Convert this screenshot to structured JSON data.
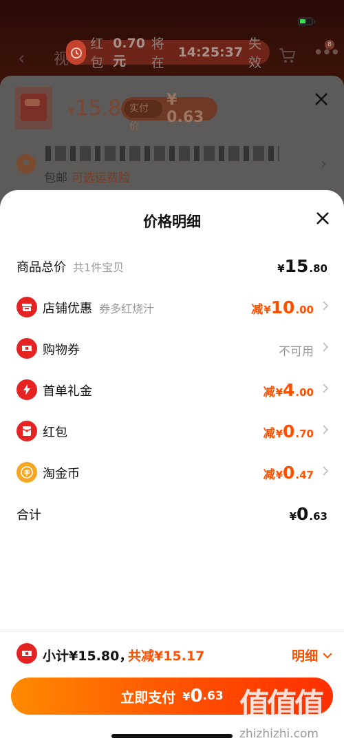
{
  "status_bar": {
    "battery_color": "#3ddc52"
  },
  "background_page": {
    "nav_back_glyph": "‹",
    "nav_title_partial": "视",
    "countdown": {
      "label": "红包",
      "amount": "0.70元",
      "mid": "将在",
      "time": "14:25:37",
      "suffix": "失效"
    },
    "cart_badge": "8",
    "product": {
      "yen": "¥",
      "price": "15.8",
      "pay_label": "实付价",
      "pay_value": "¥ 0.63"
    },
    "shipping": {
      "free": "包邮",
      "insurance": "可选运费险"
    }
  },
  "price_sheet": {
    "title": "价格明细",
    "rows": [
      {
        "label": "商品总价",
        "sub": "共1件宝贝",
        "yen": "¥",
        "int": "15",
        "dec": ".80"
      },
      {
        "label": "店铺优惠",
        "sub": "券多红烧汁",
        "minus": "减",
        "yen": "¥",
        "int": "10",
        "dec": ".00"
      },
      {
        "label": "购物券",
        "status": "不可用"
      },
      {
        "label": "首单礼金",
        "minus": "减",
        "yen": "¥",
        "int": "4",
        "dec": ".00"
      },
      {
        "label": "红包",
        "minus": "减",
        "yen": "¥",
        "int": "0",
        "dec": ".70"
      },
      {
        "label": "淘金币",
        "minus": "减",
        "yen": "¥",
        "int": "0",
        "dec": ".47"
      },
      {
        "label": "合计",
        "yen": "¥",
        "int": "0",
        "dec": ".63"
      }
    ],
    "icons": [
      "store-icon",
      "coupon-icon",
      "lightning-icon",
      "red-packet-icon",
      "coin-icon",
      "ticket-icon"
    ],
    "colors": {
      "accent": "#ff5000",
      "icon_red": "#e62323",
      "coin": "#f5a623"
    }
  },
  "summary": {
    "subtotal": "小计¥15.80，",
    "saved": "共减¥15.17",
    "detail": "明细"
  },
  "pay_button": {
    "label": "立即支付",
    "yen": "¥",
    "int": "0",
    "dec": ".63"
  },
  "watermark": {
    "logo": "值值值",
    "url": "zhizhizhi.com"
  }
}
